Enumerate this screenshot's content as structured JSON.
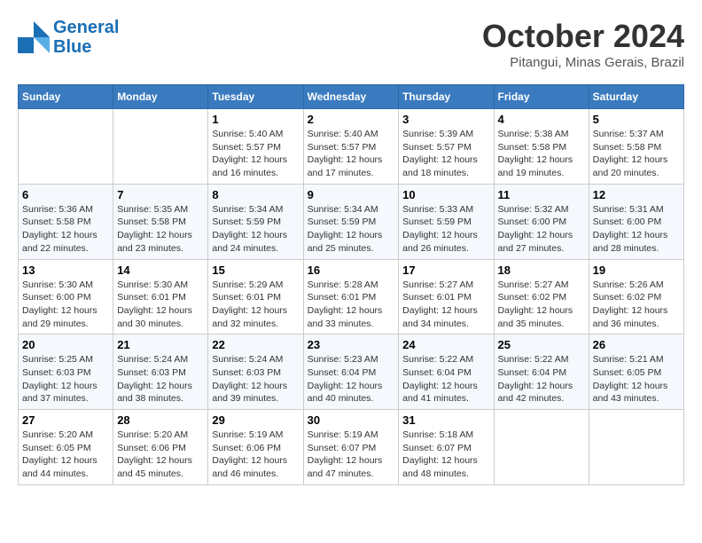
{
  "logo": {
    "line1": "General",
    "line2": "Blue"
  },
  "title": "October 2024",
  "location": "Pitangui, Minas Gerais, Brazil",
  "days_of_week": [
    "Sunday",
    "Monday",
    "Tuesday",
    "Wednesday",
    "Thursday",
    "Friday",
    "Saturday"
  ],
  "weeks": [
    [
      {
        "day": null
      },
      {
        "day": null
      },
      {
        "day": "1",
        "sunrise": "5:40 AM",
        "sunset": "5:57 PM",
        "daylight": "12 hours and 16 minutes."
      },
      {
        "day": "2",
        "sunrise": "5:40 AM",
        "sunset": "5:57 PM",
        "daylight": "12 hours and 17 minutes."
      },
      {
        "day": "3",
        "sunrise": "5:39 AM",
        "sunset": "5:57 PM",
        "daylight": "12 hours and 18 minutes."
      },
      {
        "day": "4",
        "sunrise": "5:38 AM",
        "sunset": "5:58 PM",
        "daylight": "12 hours and 19 minutes."
      },
      {
        "day": "5",
        "sunrise": "5:37 AM",
        "sunset": "5:58 PM",
        "daylight": "12 hours and 20 minutes."
      }
    ],
    [
      {
        "day": "6",
        "sunrise": "5:36 AM",
        "sunset": "5:58 PM",
        "daylight": "12 hours and 22 minutes."
      },
      {
        "day": "7",
        "sunrise": "5:35 AM",
        "sunset": "5:58 PM",
        "daylight": "12 hours and 23 minutes."
      },
      {
        "day": "8",
        "sunrise": "5:34 AM",
        "sunset": "5:59 PM",
        "daylight": "12 hours and 24 minutes."
      },
      {
        "day": "9",
        "sunrise": "5:34 AM",
        "sunset": "5:59 PM",
        "daylight": "12 hours and 25 minutes."
      },
      {
        "day": "10",
        "sunrise": "5:33 AM",
        "sunset": "5:59 PM",
        "daylight": "12 hours and 26 minutes."
      },
      {
        "day": "11",
        "sunrise": "5:32 AM",
        "sunset": "6:00 PM",
        "daylight": "12 hours and 27 minutes."
      },
      {
        "day": "12",
        "sunrise": "5:31 AM",
        "sunset": "6:00 PM",
        "daylight": "12 hours and 28 minutes."
      }
    ],
    [
      {
        "day": "13",
        "sunrise": "5:30 AM",
        "sunset": "6:00 PM",
        "daylight": "12 hours and 29 minutes."
      },
      {
        "day": "14",
        "sunrise": "5:30 AM",
        "sunset": "6:01 PM",
        "daylight": "12 hours and 30 minutes."
      },
      {
        "day": "15",
        "sunrise": "5:29 AM",
        "sunset": "6:01 PM",
        "daylight": "12 hours and 32 minutes."
      },
      {
        "day": "16",
        "sunrise": "5:28 AM",
        "sunset": "6:01 PM",
        "daylight": "12 hours and 33 minutes."
      },
      {
        "day": "17",
        "sunrise": "5:27 AM",
        "sunset": "6:01 PM",
        "daylight": "12 hours and 34 minutes."
      },
      {
        "day": "18",
        "sunrise": "5:27 AM",
        "sunset": "6:02 PM",
        "daylight": "12 hours and 35 minutes."
      },
      {
        "day": "19",
        "sunrise": "5:26 AM",
        "sunset": "6:02 PM",
        "daylight": "12 hours and 36 minutes."
      }
    ],
    [
      {
        "day": "20",
        "sunrise": "5:25 AM",
        "sunset": "6:03 PM",
        "daylight": "12 hours and 37 minutes."
      },
      {
        "day": "21",
        "sunrise": "5:24 AM",
        "sunset": "6:03 PM",
        "daylight": "12 hours and 38 minutes."
      },
      {
        "day": "22",
        "sunrise": "5:24 AM",
        "sunset": "6:03 PM",
        "daylight": "12 hours and 39 minutes."
      },
      {
        "day": "23",
        "sunrise": "5:23 AM",
        "sunset": "6:04 PM",
        "daylight": "12 hours and 40 minutes."
      },
      {
        "day": "24",
        "sunrise": "5:22 AM",
        "sunset": "6:04 PM",
        "daylight": "12 hours and 41 minutes."
      },
      {
        "day": "25",
        "sunrise": "5:22 AM",
        "sunset": "6:04 PM",
        "daylight": "12 hours and 42 minutes."
      },
      {
        "day": "26",
        "sunrise": "5:21 AM",
        "sunset": "6:05 PM",
        "daylight": "12 hours and 43 minutes."
      }
    ],
    [
      {
        "day": "27",
        "sunrise": "5:20 AM",
        "sunset": "6:05 PM",
        "daylight": "12 hours and 44 minutes."
      },
      {
        "day": "28",
        "sunrise": "5:20 AM",
        "sunset": "6:06 PM",
        "daylight": "12 hours and 45 minutes."
      },
      {
        "day": "29",
        "sunrise": "5:19 AM",
        "sunset": "6:06 PM",
        "daylight": "12 hours and 46 minutes."
      },
      {
        "day": "30",
        "sunrise": "5:19 AM",
        "sunset": "6:07 PM",
        "daylight": "12 hours and 47 minutes."
      },
      {
        "day": "31",
        "sunrise": "5:18 AM",
        "sunset": "6:07 PM",
        "daylight": "12 hours and 48 minutes."
      },
      {
        "day": null
      },
      {
        "day": null
      }
    ]
  ]
}
